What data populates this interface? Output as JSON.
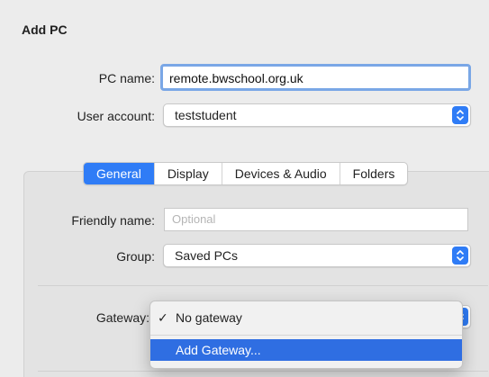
{
  "dialog": {
    "title": "Add PC"
  },
  "pc_name": {
    "label": "PC name:",
    "value": "remote.bwschool.org.uk"
  },
  "user_account": {
    "label": "User account:",
    "selected": "teststudent"
  },
  "tabs": [
    {
      "label": "General",
      "active": true
    },
    {
      "label": "Display",
      "active": false
    },
    {
      "label": "Devices & Audio",
      "active": false
    },
    {
      "label": "Folders",
      "active": false
    }
  ],
  "general": {
    "friendly_name": {
      "label": "Friendly name:",
      "placeholder": "Optional"
    },
    "group": {
      "label": "Group:",
      "selected": "Saved PCs"
    },
    "gateway": {
      "label": "Gateway:",
      "menu": [
        {
          "label": "No gateway",
          "checked": true
        },
        {
          "label": "Add Gateway...",
          "highlighted": true
        }
      ]
    }
  },
  "colors": {
    "accent": "#2f7cf6",
    "menu_highlight": "#2f6ee2",
    "focus_ring": "#7aa7e6"
  }
}
